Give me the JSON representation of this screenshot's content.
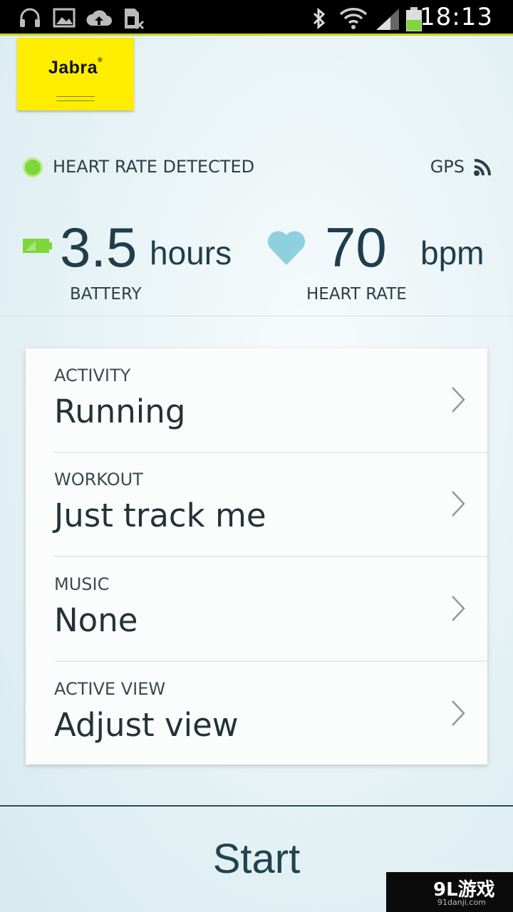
{
  "status_bar": {
    "time": "18:13",
    "icons": [
      "headphones-icon",
      "image-icon",
      "cloud-upload-icon",
      "sim-blocked-icon",
      "bluetooth-icon",
      "wifi-icon",
      "signal-icon",
      "battery-icon"
    ]
  },
  "logo": {
    "text": "Jabra",
    "reg": "®"
  },
  "sensors": {
    "heart_rate_status": "HEART RATE DETECTED",
    "gps_label": "GPS",
    "status_color": "#7fd63a"
  },
  "stats": {
    "battery": {
      "value": "3.5",
      "unit": "hours",
      "label": "BATTERY"
    },
    "heart_rate": {
      "value": "70",
      "unit": "bpm",
      "label": "HEART RATE"
    }
  },
  "settings": [
    {
      "label": "ACTIVITY",
      "value": "Running"
    },
    {
      "label": "WORKOUT",
      "value": "Just track me"
    },
    {
      "label": "MUSIC",
      "value": "None"
    },
    {
      "label": "ACTIVE VIEW",
      "value": "Adjust view"
    }
  ],
  "start": {
    "label": "Start"
  },
  "watermark": {
    "main": "9L游戏",
    "sub": "91danji.com"
  },
  "colors": {
    "accent_yellow": "#ffed00",
    "heart": "#8fd0df",
    "battery_green": "#7fd63a"
  }
}
